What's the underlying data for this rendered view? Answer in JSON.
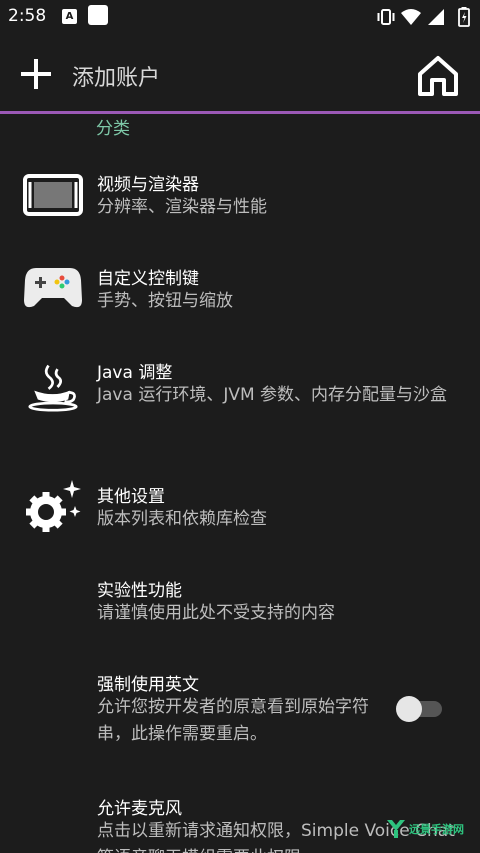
{
  "status_bar": {
    "time": "2:58",
    "notification_letter": "A"
  },
  "toolbar": {
    "title": "添加账户"
  },
  "settings": {
    "category_label": "分类",
    "items": [
      {
        "title": "视频与渲染器",
        "subtitle": "分辨率、渲染器与性能",
        "icon": "display-icon"
      },
      {
        "title": "自定义控制键",
        "subtitle": "手势、按钮与缩放",
        "icon": "gamepad-icon"
      },
      {
        "title": "Java 调整",
        "subtitle": "Java 运行环境、JVM 参数、内存分配量与沙盒",
        "icon": "java-icon"
      },
      {
        "title": "其他设置",
        "subtitle": "版本列表和依赖库检查",
        "icon": "gear-sparkle-icon"
      },
      {
        "title": "实验性功能",
        "subtitle": "请谨慎使用此处不受支持的内容",
        "icon": ""
      },
      {
        "title": "强制使用英文",
        "subtitle": "允许您按开发者的原意看到原始字符串，此操作需要重启。",
        "icon": "",
        "toggle": false
      },
      {
        "title": "允许麦克风",
        "subtitle": "点击以重新请求通知权限，Simple Voice Chat等语音聊天模组需要此权限",
        "icon": ""
      }
    ]
  },
  "watermark": {
    "text": "远景手游网"
  },
  "colors": {
    "background": "#1c1c1c",
    "accent": "#9b59b6",
    "category": "#7ec8a8",
    "subtitle": "#bdbdbd"
  }
}
